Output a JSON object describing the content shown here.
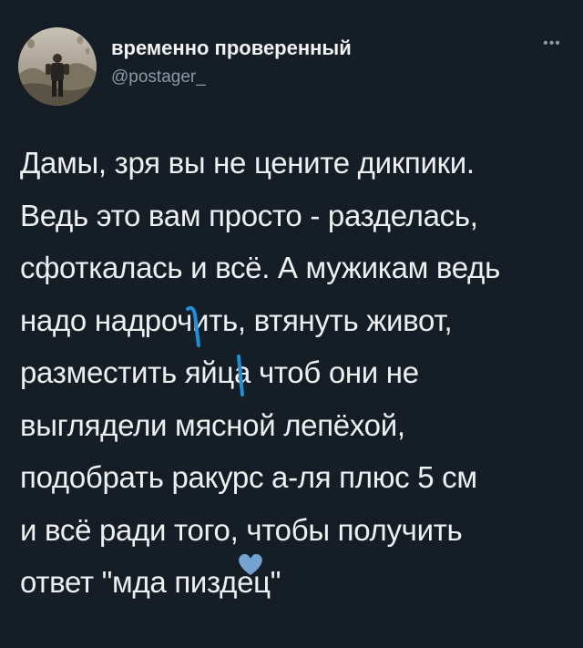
{
  "tweet": {
    "author_name": "временно проверенный",
    "author_handle": "@postager_",
    "more_icon": "more-dots-icon",
    "lines": [
      "Дамы, зря вы не цените дикпики.",
      "Ведь это вам просто - разделась,",
      "сфоткалась и всё. А мужикам ведь",
      "надо надрочить, втянуть живот,",
      "разместить яйца чтоб они не",
      "выглядели мясной лепёхой,",
      "подобрать ракурс а-ля плюс 5 см",
      "и всё ради того, чтобы получить",
      "ответ \"мда пиздец\""
    ]
  },
  "colors": {
    "background": "#151d26",
    "text": "#eef0f1",
    "muted": "#8b98a5",
    "censor": "#1e8fd8"
  }
}
